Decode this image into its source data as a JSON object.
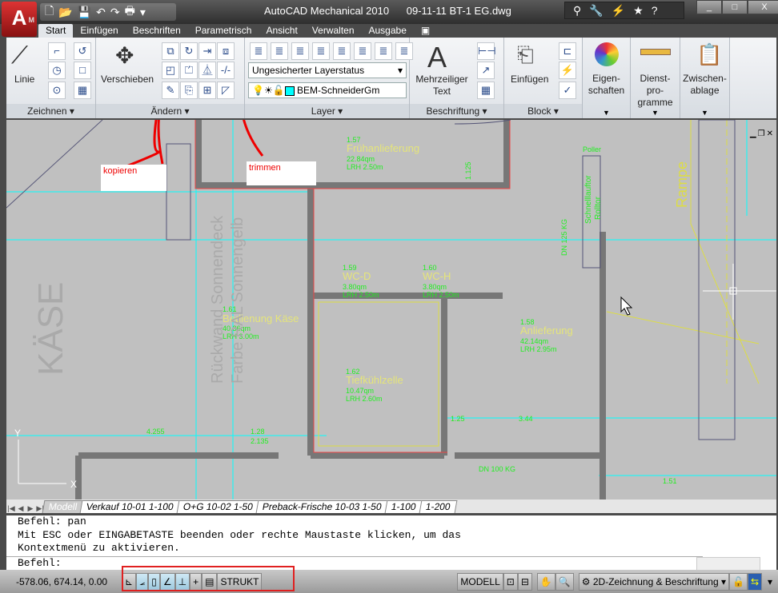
{
  "app": {
    "logo_letter": "A",
    "logo_sub": "M",
    "title": "AutoCAD Mechanical 2010",
    "document": "09-11-11 BT-1 EG.dwg"
  },
  "qat": {
    "icons": [
      "new-icon",
      "open-icon",
      "save-icon",
      "undo-icon",
      "redo-icon",
      "plot-icon"
    ]
  },
  "window": {
    "minimize": "_",
    "maximize": "□",
    "close": "X"
  },
  "tabs": [
    {
      "label": "Start",
      "active": true
    },
    {
      "label": "Einfügen"
    },
    {
      "label": "Beschriften"
    },
    {
      "label": "Parametrisch"
    },
    {
      "label": "Ansicht"
    },
    {
      "label": "Verwalten"
    },
    {
      "label": "Ausgabe"
    }
  ],
  "ribbon": {
    "zeichnen": {
      "label": "Zeichnen",
      "linie": "Linie"
    },
    "aendern": {
      "label": "Ändern",
      "verschieben": "Verschieben"
    },
    "layer": {
      "label": "Layer",
      "layer_state": "Ungesicherter Layerstatus",
      "current_layer": "BEM-SchneiderGm"
    },
    "beschriftung": {
      "label": "Beschriftung",
      "text_line1": "Mehrzeiliger",
      "text_line2": "Text"
    },
    "block": {
      "label": "Block",
      "einfuegen": "Einfügen"
    },
    "eigenschaften": {
      "line1": "Eigen-",
      "line2": "schaften"
    },
    "dienstprogramme": {
      "line1": "Dienst-",
      "line2": "pro-",
      "line3": "gramme"
    },
    "zwischenablage": {
      "line1": "Zwischen-",
      "line2": "ablage"
    }
  },
  "annotations": {
    "copy": "kopieren",
    "trim": "trimmen"
  },
  "drawing": {
    "rooms": [
      {
        "num": "1.57",
        "name": "Frühanlieferung",
        "area": "22.84qm",
        "height": "LRH 2.50m"
      },
      {
        "num": "1.59",
        "name": "WC-D",
        "area": "3.80qm",
        "height": "LRH 2.50m"
      },
      {
        "num": "1.60",
        "name": "WC-H",
        "area": "3.80qm",
        "height": "LRH 2.50m"
      },
      {
        "num": "1.61",
        "name": "Bedienung Käse",
        "area": "40.36qm",
        "height": "LRH 3.00m"
      },
      {
        "num": "1.62",
        "name": "Tiefkühlzelle",
        "area": "10.47qm",
        "height": "LRH 2.60m"
      },
      {
        "num": "1.58",
        "name": "Anlieferung",
        "area": "42.14qm",
        "height": "LRH 2.95m"
      }
    ],
    "labels": {
      "kaese": "KÄSE",
      "rampe": "Rampe",
      "rueckwand": "Rückwand Sonnendeck",
      "farbe": "Farbe RAL Sonnengelb",
      "schnelllauftor": "Schnelllauftor",
      "rolltor": "Rolltor",
      "poller": "Poller",
      "dn100": "DN 100 KG",
      "dn125": "DN 125 KG",
      "dim1": "4.255",
      "dim2": "2.135",
      "dim3": "3.44",
      "dim4": "1.25",
      "dim5": "1.51",
      "dim6": "1.125",
      "dim7": "1.28",
      "ucs_x": "X",
      "ucs_y": "Y"
    }
  },
  "layout_tabs": [
    {
      "label": "Modell",
      "active": true
    },
    {
      "label": "Verkauf 10-01 1-100"
    },
    {
      "label": "O+G 10-02 1-50"
    },
    {
      "label": "Preback-Frische 10-03 1-50"
    },
    {
      "label": "1-100"
    },
    {
      "label": "1-200"
    }
  ],
  "command": {
    "lines": [
      "Befehl: pan",
      "Mit ESC oder EINGABETASTE beenden oder rechte Maustaste klicken, um das",
      "Kontextmenü zu aktivieren."
    ],
    "prompt": "Befehl:"
  },
  "status": {
    "coords": "-578.06, 674.14, 0.00",
    "strukt": "STRUKT",
    "modell": "MODELL",
    "workspace": "2D-Zeichnung & Beschriftung"
  }
}
